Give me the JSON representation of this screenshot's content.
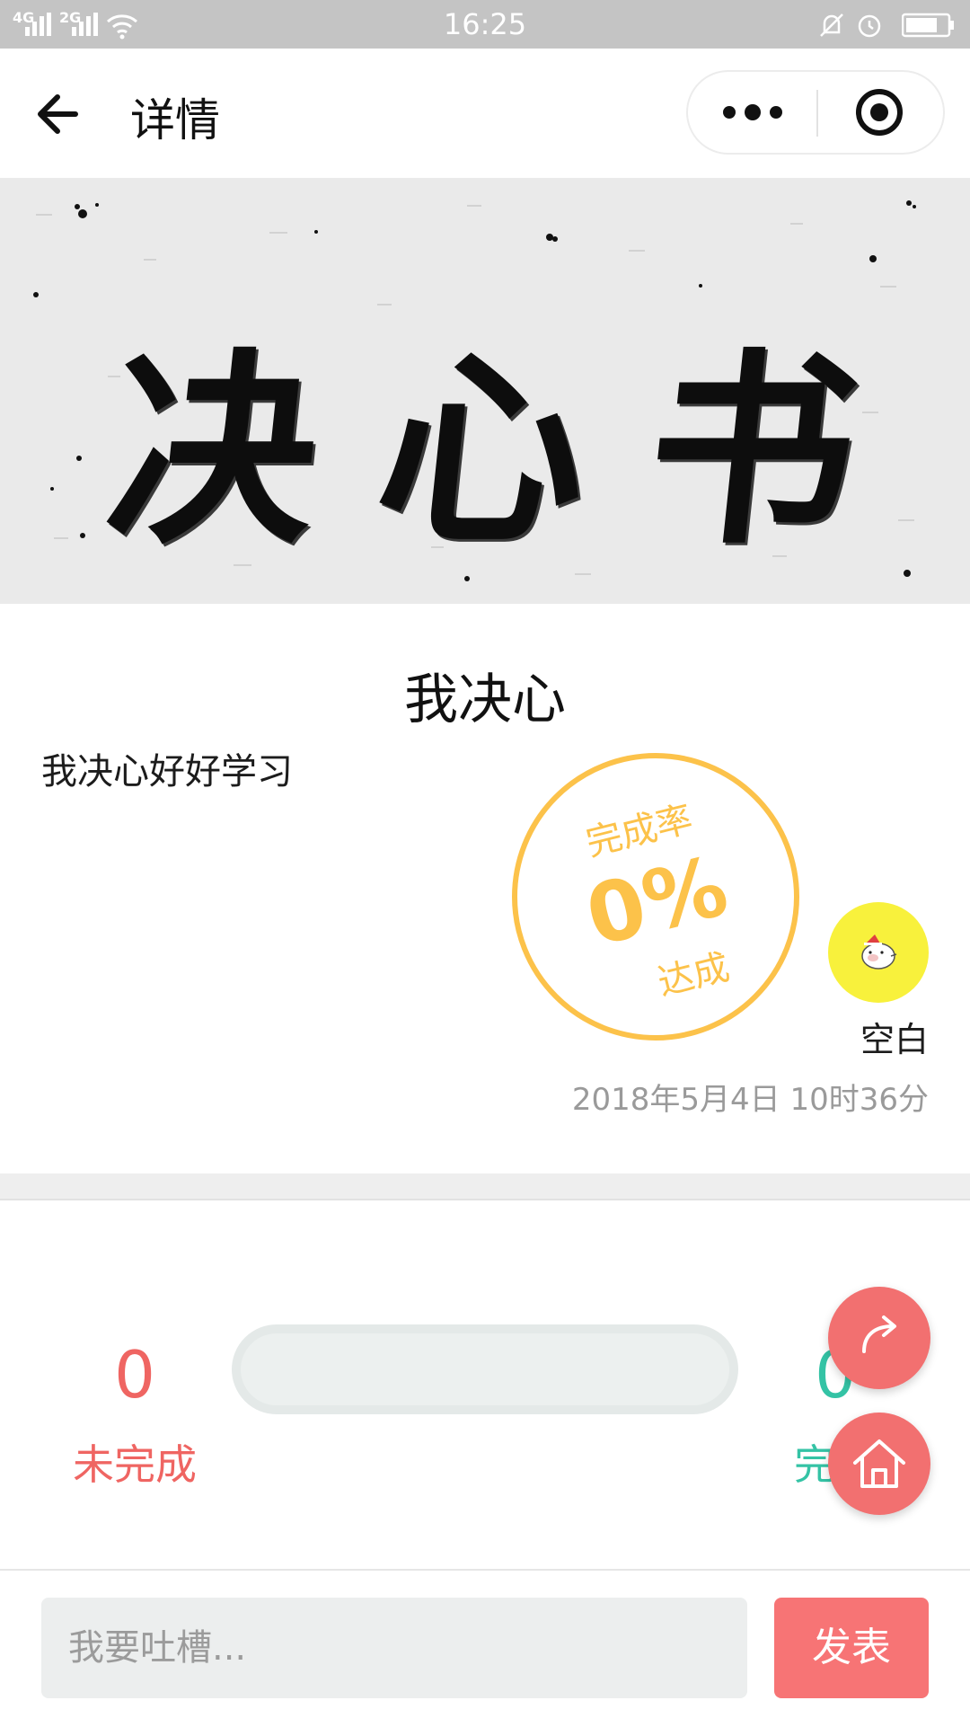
{
  "status_bar": {
    "network_1": "4G",
    "network_2": "2G",
    "time": "16:25"
  },
  "nav": {
    "title": "详情",
    "icons": {
      "back": "arrow-left-icon",
      "more": "more-dots-icon",
      "close": "target-circle-icon"
    }
  },
  "banner": {
    "title": "决心书"
  },
  "resolution": {
    "title": "我决心",
    "body": "我决心好好学习",
    "completion": {
      "label_top": "完成率",
      "percent_text": "0%",
      "label_bottom": "达成"
    },
    "author": {
      "name": "空白",
      "avatar": "pig-avatar-icon"
    },
    "timestamp": "2018年5月4日 10时36分"
  },
  "stats": {
    "incomplete_count": "0",
    "incomplete_label": "未完成",
    "complete_count": "0",
    "complete_label": "完成",
    "progress_fraction": 0
  },
  "fabs": {
    "share": "share-arrow-icon",
    "home": "home-icon"
  },
  "comment": {
    "placeholder": "我要吐槽...",
    "submit_label": "发表"
  },
  "colors": {
    "status_bar": "#c4c4c4",
    "stamp": "#fcc24a",
    "incomplete": "#ef6562",
    "complete": "#34c3a5",
    "fab": "#f27070",
    "post_button": "#f77475",
    "avatar_bg": "#f8f13c"
  }
}
